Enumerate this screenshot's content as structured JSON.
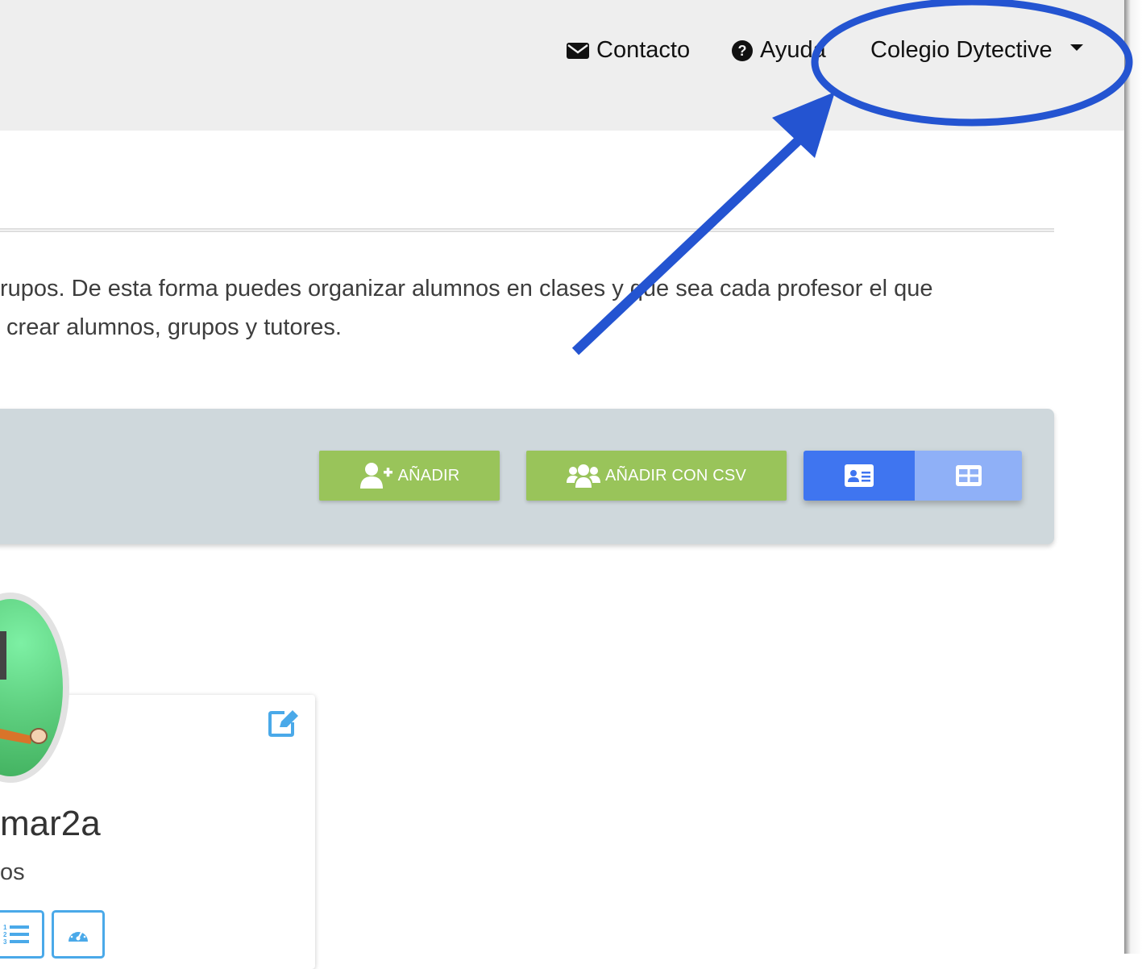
{
  "navbar": {
    "contact_label": "Contacto",
    "help_label": "Ayuda",
    "user_label": "Colegio Dytective"
  },
  "description": {
    "line1": "rupos. De esta forma puedes organizar alumnos en clases y que sea cada profesor el que",
    "line2": " crear alumnos, grupos y tutores."
  },
  "toolbar": {
    "add_label": "AÑADIR",
    "add_csv_label": "AÑADIR CON CSV",
    "view_options": [
      "card-view",
      "grid-view"
    ],
    "selected_view": "card-view"
  },
  "student_card": {
    "name": "mar2a",
    "subtitle": "os"
  },
  "icons": [
    "envelope-icon",
    "question-circle-icon",
    "caret-down-icon",
    "user-plus-icon",
    "users-icon",
    "id-card-icon",
    "grid-icon",
    "edit-icon",
    "list-ol-icon",
    "gauge-icon"
  ],
  "colors": {
    "navbar_bg": "#eeeeee",
    "toolbar_bg": "#cfd8dc",
    "button_green": "#99c45a",
    "toggle_active": "#3f75f0",
    "toggle_inactive": "#8fb0f7",
    "card_accent": "#4aa9e9",
    "annotation_blue": "#2454d1"
  }
}
